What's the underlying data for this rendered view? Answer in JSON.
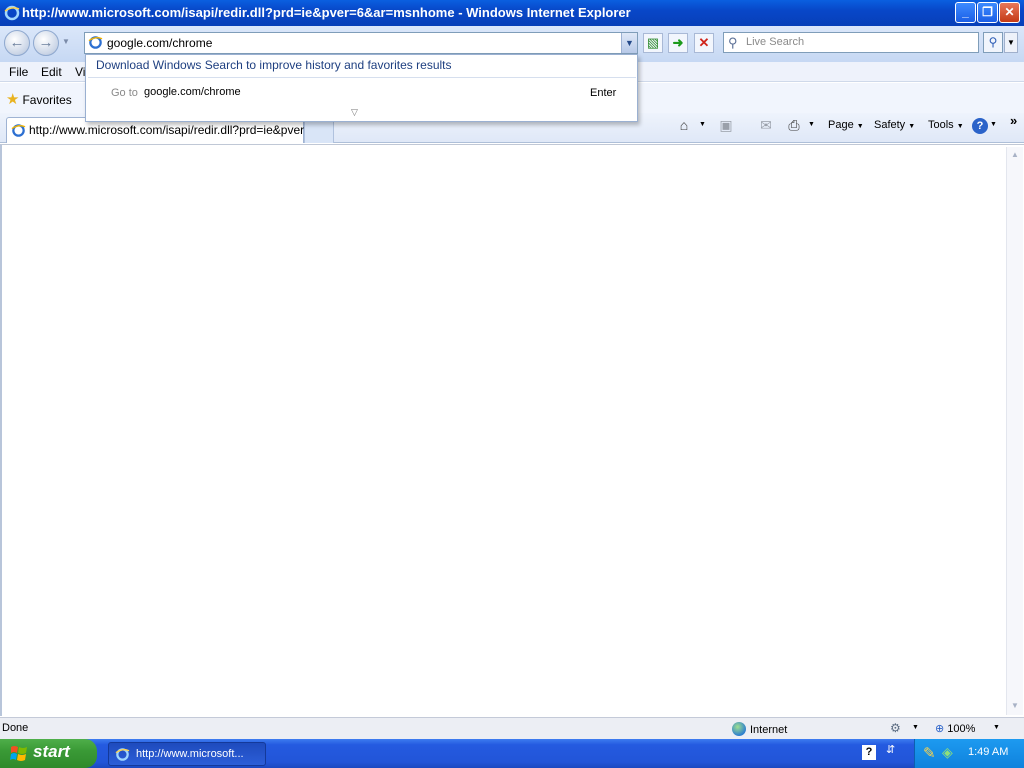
{
  "window": {
    "title": "http://www.microsoft.com/isapi/redir.dll?prd=ie&pver=6&ar=msnhome - Windows Internet Explorer"
  },
  "address_bar": {
    "value": "google.com/chrome"
  },
  "search": {
    "placeholder": "Live Search"
  },
  "menu": {
    "items": [
      "File",
      "Edit",
      "Vi"
    ]
  },
  "favorites": {
    "label": "Favorites"
  },
  "dropdown": {
    "download_text": "Download Windows Search to improve history and favorites results",
    "goto_label": "Go to",
    "goto_value": "google.com/chrome",
    "enter_label": "Enter"
  },
  "tab": {
    "title": "http://www.microsoft.com/isapi/redir.dll?prd=ie&pver..."
  },
  "command_bar": {
    "page": "Page",
    "safety": "Safety",
    "tools": "Tools"
  },
  "status": {
    "text": "Done",
    "zone": "Internet",
    "zoom": "100%"
  },
  "taskbar": {
    "start": "start",
    "task_label": "http://www.microsoft...",
    "clock": "1:49 AM"
  },
  "colors": {
    "titlebar": "#0847c8",
    "taskbar": "#245ae0",
    "start": "#3a9a36"
  }
}
